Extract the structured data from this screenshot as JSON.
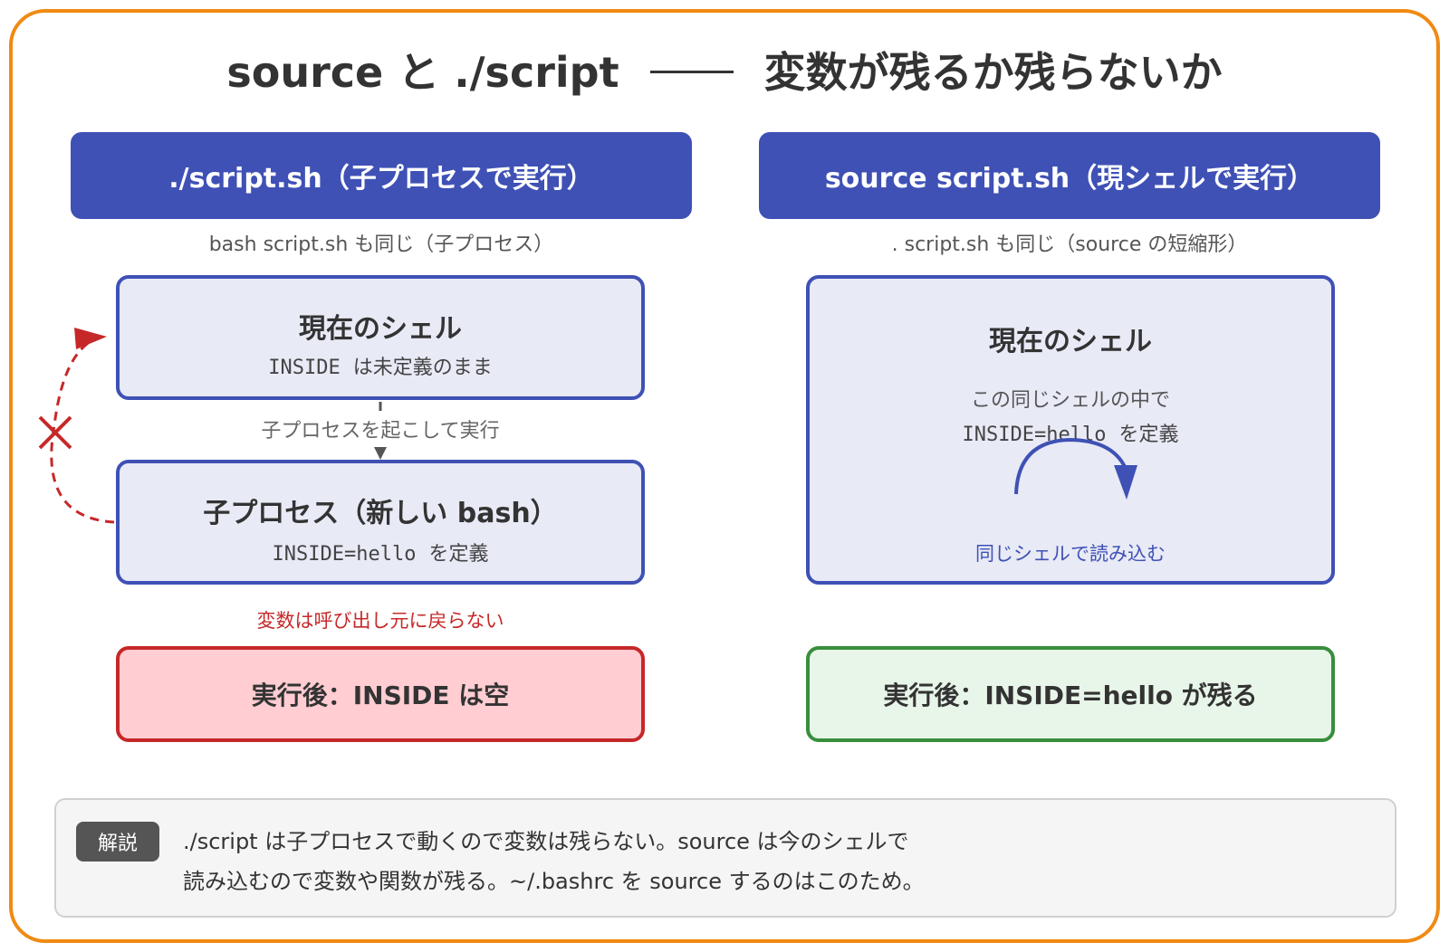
{
  "title": {
    "left": "source と ./script",
    "right": "変数が残るか残らないか"
  },
  "left_column": {
    "header": "./script.sh（子プロセスで実行）",
    "note": "bash script.sh も同じ（子プロセス）",
    "current_shell": {
      "title": "現在のシェル",
      "code": "INSIDE",
      "text": "は未定義のまま"
    },
    "flow_label": "子プロセスを起こして実行",
    "child_process": {
      "title": "子プロセス（新しい bash）",
      "code": "INSIDE=hello",
      "text": "を定義"
    },
    "warning": "変数は呼び出し元に戻らない",
    "result": "実行後：INSIDE は空"
  },
  "right_column": {
    "header": "source script.sh（現シェルで実行）",
    "note": ". script.sh も同じ（source の短縮形）",
    "current_shell": {
      "title": "現在のシェル",
      "line1": "この同じシェルの中で",
      "code": "INSIDE=hello",
      "text": "を定義",
      "caption": "同じシェルで読み込む"
    },
    "result": "実行後：INSIDE=hello が残る"
  },
  "explanation": {
    "badge": "解説",
    "line1": "./script は子プロセスで動くので変数は残らない。source は今のシェルで",
    "line2": "読み込むので変数や関数が残る。~/.bashrc を source するのはこのため。"
  },
  "colors": {
    "frame": "#f08a12",
    "header": "#3f51b5",
    "error": "#c62828",
    "success": "#388e3c"
  }
}
